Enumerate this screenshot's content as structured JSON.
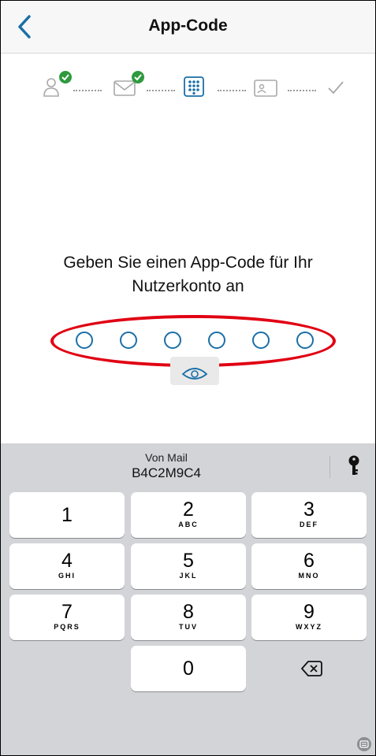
{
  "nav": {
    "title": "App-Code",
    "back_icon": "chevron-left-icon"
  },
  "steps": [
    {
      "icon": "person-icon",
      "status": "done"
    },
    {
      "icon": "envelope-icon",
      "status": "done"
    },
    {
      "icon": "keypad-icon",
      "status": "current"
    },
    {
      "icon": "id-card-icon",
      "status": "pending"
    },
    {
      "icon": "checkmark-icon",
      "status": "pending"
    }
  ],
  "prompt": {
    "line1": "Geben Sie einen App-Code für Ihr",
    "line2": "Nutzerkonto an"
  },
  "code": {
    "length": 6,
    "filled": 0
  },
  "keyboard": {
    "suggestion_label": "Von Mail",
    "suggestion_value": "B4C2M9C4",
    "keys": [
      {
        "num": "1",
        "letters": ""
      },
      {
        "num": "2",
        "letters": "ABC"
      },
      {
        "num": "3",
        "letters": "DEF"
      },
      {
        "num": "4",
        "letters": "GHI"
      },
      {
        "num": "5",
        "letters": "JKL"
      },
      {
        "num": "6",
        "letters": "MNO"
      },
      {
        "num": "7",
        "letters": "PQRS"
      },
      {
        "num": "8",
        "letters": "TUV"
      },
      {
        "num": "9",
        "letters": "WXYZ"
      },
      {
        "num": "0",
        "letters": ""
      }
    ]
  },
  "colors": {
    "accent": "#1a6fa8",
    "check": "#2e9a3e",
    "highlight": "#e00012"
  }
}
